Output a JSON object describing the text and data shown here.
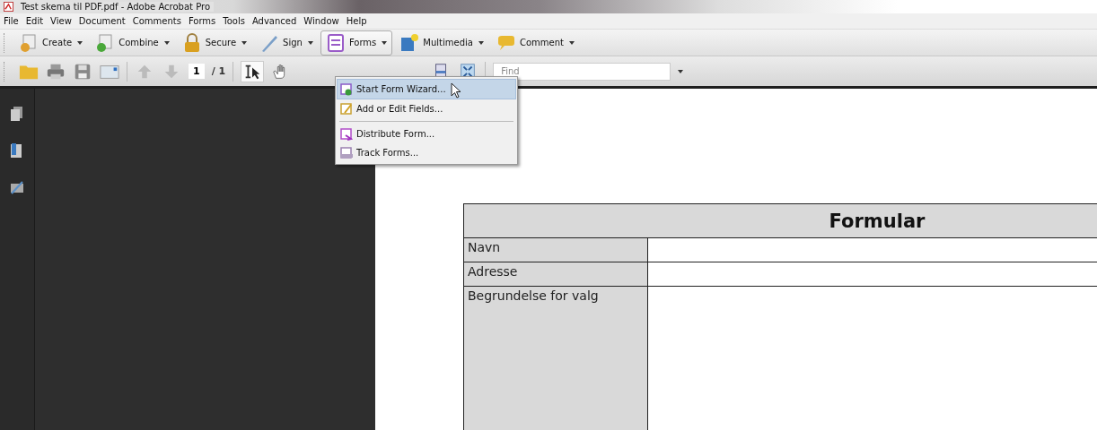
{
  "window": {
    "title": "Test skema til PDF.pdf - Adobe Acrobat Pro"
  },
  "menu_bar": [
    "File",
    "Edit",
    "View",
    "Document",
    "Comments",
    "Forms",
    "Tools",
    "Advanced",
    "Window",
    "Help"
  ],
  "task_buttons": [
    {
      "label": "Create",
      "kind": "create",
      "selected": false
    },
    {
      "label": "Combine",
      "kind": "combine",
      "selected": false
    },
    {
      "label": "Secure",
      "kind": "secure",
      "selected": false
    },
    {
      "label": "Sign",
      "kind": "sign",
      "selected": false
    },
    {
      "label": "Forms",
      "kind": "forms",
      "selected": true
    },
    {
      "label": "Multimedia",
      "kind": "multimedia",
      "selected": false
    },
    {
      "label": "Comment",
      "kind": "comment",
      "selected": false
    }
  ],
  "toolbar": {
    "page_number": "1",
    "page_count": "/ 1",
    "find": {
      "placeholder": "Find"
    }
  },
  "forms_menu": [
    {
      "items": [
        {
          "label": "Start Form Wizard...",
          "kind": "wizard",
          "selected": true
        },
        {
          "label": "Add or Edit Fields...",
          "kind": "edit",
          "selected": false
        }
      ]
    },
    {
      "items": [
        {
          "label": "Distribute Form...",
          "kind": "distribute",
          "selected": false
        },
        {
          "label": "Track Forms...",
          "kind": "track",
          "selected": false
        }
      ]
    }
  ],
  "document": {
    "form_title": "Formular",
    "rows": [
      {
        "label": "Navn",
        "kind": "line"
      },
      {
        "label": "Adresse",
        "kind": "line"
      },
      {
        "label": "Begrundelse for valg",
        "kind": "area"
      }
    ]
  }
}
